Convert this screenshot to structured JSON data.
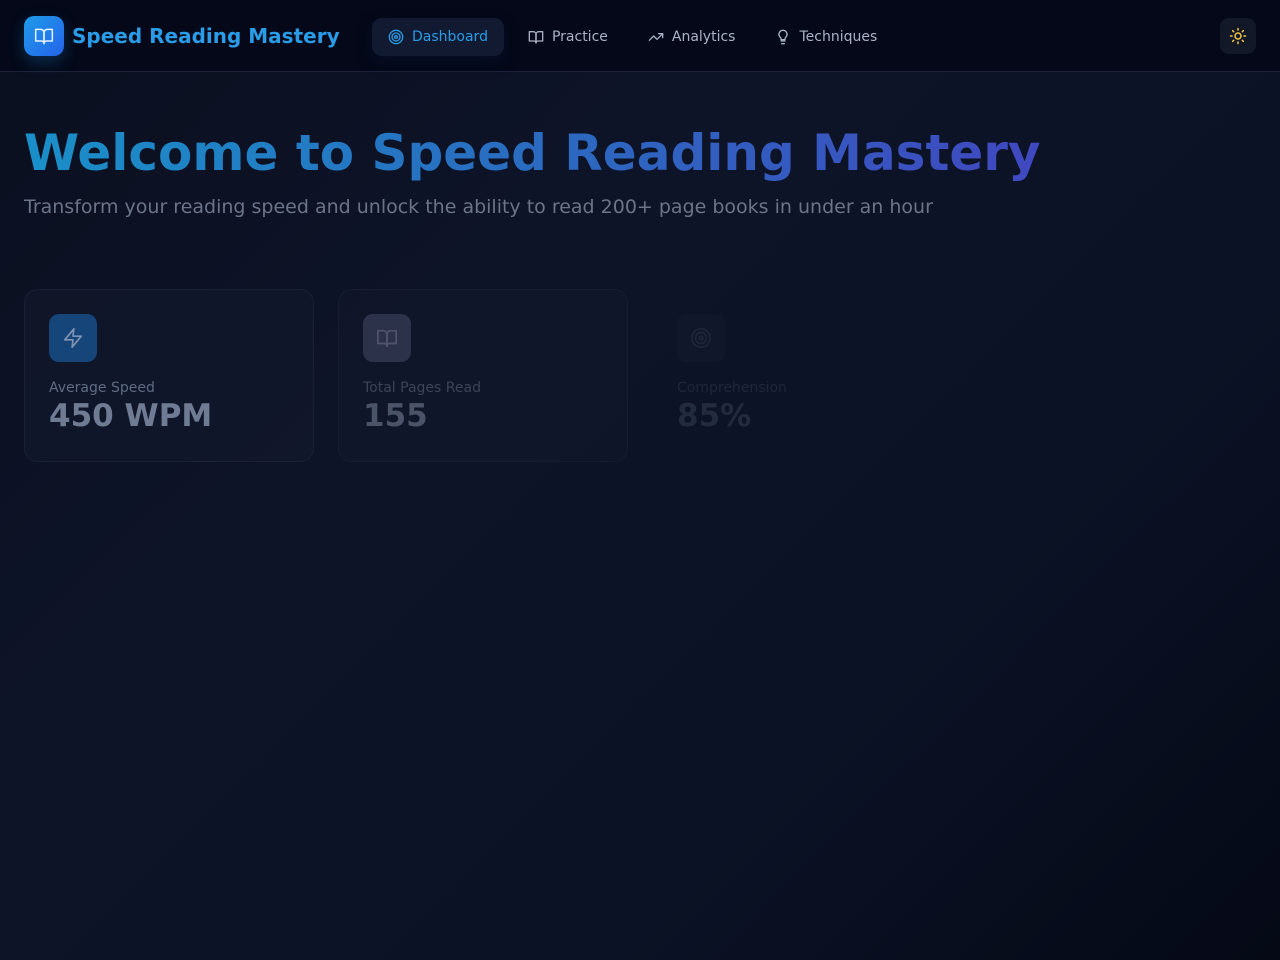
{
  "app": {
    "name": "Speed Reading Mastery",
    "logo_icon": "open-book-icon",
    "brand_color": "#2a9be6"
  },
  "nav": {
    "items": [
      {
        "label": "Dashboard",
        "icon": "target-icon",
        "active": true
      },
      {
        "label": "Practice",
        "icon": "book-icon",
        "active": false
      },
      {
        "label": "Analytics",
        "icon": "trending-up-icon",
        "active": false
      },
      {
        "label": "Techniques",
        "icon": "lightbulb-icon",
        "active": false
      }
    ],
    "theme_toggle_icon": "sun-icon"
  },
  "hero": {
    "title": "Welcome to Speed Reading Mastery",
    "subtitle": "Transform your reading speed and unlock the ability to read 200+ page books in under an hour"
  },
  "stats": [
    {
      "label": "Average Speed",
      "value": "450 WPM",
      "icon": "lightning-icon"
    },
    {
      "label": "Total Pages Read",
      "value": "155",
      "icon": "book-icon"
    },
    {
      "label": "Comprehension",
      "value": "85%",
      "icon": "target-icon"
    }
  ]
}
